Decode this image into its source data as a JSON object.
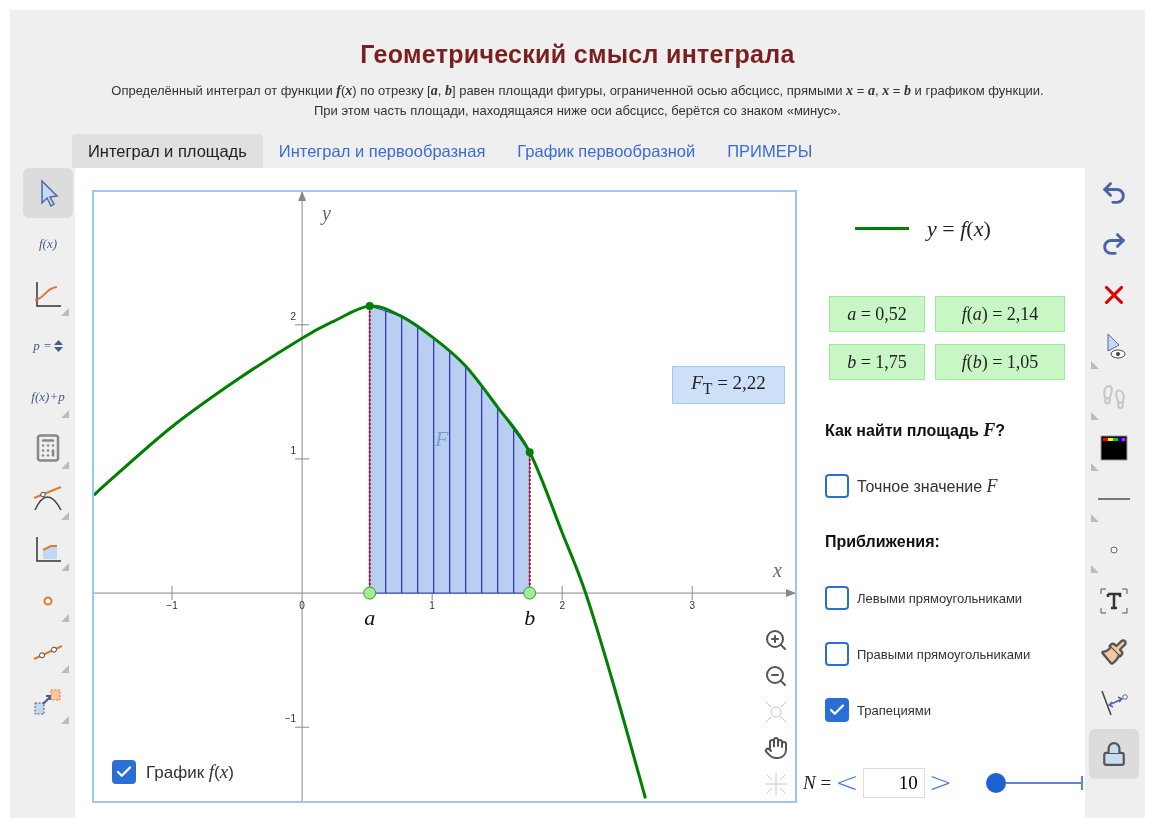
{
  "header": {
    "title": "Геометрический смысл интеграла",
    "description_lines": [
      "Определённый интеграл от функции *f*(*x*) по отрезку [*a*, *b*] равен площади фигуры, ограниченной осью абсцисс, прямыми *x* = *a*, *x* = *b* и графиком функции.",
      "При этом часть площади, находящаяся ниже оси абсцисс, берётся со знаком «минус»."
    ]
  },
  "tabs": [
    {
      "label": "Интеграл и площадь",
      "selected": true
    },
    {
      "label": "Интеграл и первообразная",
      "selected": false
    },
    {
      "label": "График первообразной",
      "selected": false
    },
    {
      "label": "ПРИМЕРЫ",
      "selected": false
    }
  ],
  "left_toolbar": [
    {
      "kind": "pointer",
      "selected": true,
      "has_menu": false
    },
    {
      "kind": "text",
      "label": "f(x)",
      "selected": false,
      "has_menu": false
    },
    {
      "kind": "graph",
      "selected": false,
      "has_menu": true
    },
    {
      "kind": "slider",
      "label": "p =",
      "selected": false,
      "has_menu": false
    },
    {
      "kind": "text",
      "label": "f(x)+p",
      "selected": false,
      "has_menu": true
    },
    {
      "kind": "calculator",
      "selected": false,
      "has_menu": true
    },
    {
      "kind": "tangent",
      "selected": false,
      "has_menu": true
    },
    {
      "kind": "area",
      "selected": false,
      "has_menu": true
    },
    {
      "kind": "point",
      "selected": false,
      "has_menu": true
    },
    {
      "kind": "line",
      "selected": false,
      "has_menu": true
    },
    {
      "kind": "transform",
      "selected": false,
      "has_menu": true
    }
  ],
  "graph": {
    "area_label": "F",
    "approximation_label": "*F*$_{T}$ = 2,22",
    "show_graph": {
      "label": "График *f*(*x*)",
      "checked": true
    },
    "chart_data": {
      "type": "line",
      "xlabel": "x",
      "ylabel": "y",
      "xlim": [
        -1.6,
        3.79
      ],
      "ylim": [
        -1.55,
        2.99
      ],
      "xticks": [
        {
          "value": -1,
          "label": "−1"
        },
        {
          "value": 0,
          "label": "0"
        },
        {
          "value": 1,
          "label": "1"
        },
        {
          "value": 2,
          "label": "2"
        },
        {
          "value": 3,
          "label": "3"
        }
      ],
      "yticks": [
        {
          "value": -1,
          "label": "−1"
        },
        {
          "value": 1,
          "label": "1"
        },
        {
          "value": 2,
          "label": "2"
        }
      ],
      "x": [
        -1.6,
        -1.5,
        -1,
        -0.5,
        0,
        0.25,
        0.52,
        0.75,
        1,
        1.25,
        1.5,
        1.75,
        2,
        2.18,
        2.4,
        2.64
      ],
      "series": [
        {
          "color": "#008000",
          "values": [
            0.73,
            0.82,
            1.24,
            1.59,
            1.9,
            2.03,
            2.14,
            2.07,
            1.91,
            1.7,
            1.39,
            1.05,
            0.45,
            0,
            -0.7,
            -1.53
          ]
        }
      ],
      "annotations": [
        {
          "text": "a",
          "x": 0.52,
          "y": 0
        },
        {
          "text": "b",
          "x": 1.75,
          "y": 0
        }
      ]
    },
    "view_controls": [
      {
        "kind": "zoom-in",
        "disabled": false
      },
      {
        "kind": "zoom-out",
        "disabled": false
      },
      {
        "kind": "fit",
        "disabled": true
      },
      {
        "kind": "pan",
        "disabled": false
      },
      {
        "kind": "center",
        "disabled": true
      }
    ]
  },
  "panel": {
    "legend": "*y* = *f*(*x*)",
    "values": [
      "*a* = 0,52",
      "*f*(*a*) = 2,14",
      "*b* = 1,75",
      "*f*(*b*) = 1,05"
    ],
    "items": [
      {
        "kind": "heading",
        "text": "Как найти площадь *F*?"
      },
      {
        "kind": "main-option",
        "text": "Точное значение *F*",
        "checked": false
      },
      {
        "kind": "heading",
        "text": "Приближения:"
      },
      {
        "kind": "option",
        "text": "Левыми прямоугольниками",
        "checked": false
      },
      {
        "kind": "option",
        "text": "Правыми прямоугольниками",
        "checked": false
      },
      {
        "kind": "option",
        "text": "Трапециями",
        "checked": true
      }
    ],
    "stepper": {
      "label": "*N* =",
      "previous": "<",
      "value": "10",
      "next": ">",
      "level": 0
    }
  },
  "right_toolbar": [
    {
      "kind": "undo",
      "selected": false,
      "has_menu": false
    },
    {
      "kind": "redo",
      "selected": false,
      "has_menu": false
    },
    {
      "kind": "delete",
      "selected": false,
      "has_menu": false
    },
    {
      "kind": "visibility",
      "selected": false,
      "has_menu": true
    },
    {
      "kind": "footprints",
      "selected": false,
      "has_menu": true
    },
    {
      "kind": "color",
      "selected": false,
      "has_menu": true
    },
    {
      "kind": "line-style",
      "selected": false,
      "has_menu": true
    },
    {
      "kind": "point-style",
      "selected": false,
      "has_menu": true
    },
    {
      "kind": "text-tool",
      "selected": false,
      "has_menu": false
    },
    {
      "kind": "brush",
      "selected": false,
      "has_menu": false
    },
    {
      "kind": "angle",
      "selected": false,
      "has_menu": false
    },
    {
      "kind": "lock",
      "selected": true,
      "has_menu": false
    }
  ]
}
